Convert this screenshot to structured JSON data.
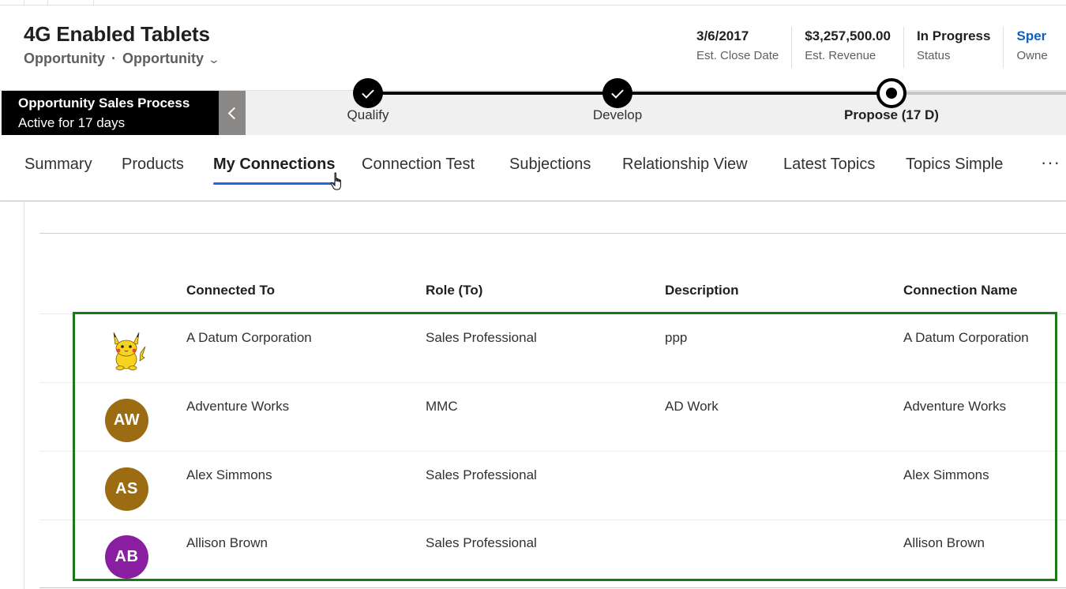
{
  "record": {
    "title": "4G Enabled Tablets",
    "entity": "Opportunity",
    "separator": "·",
    "form": "Opportunity"
  },
  "header_fields": [
    {
      "value": "3/6/2017",
      "label": "Est. Close Date"
    },
    {
      "value": "$3,257,500.00",
      "label": "Est. Revenue"
    },
    {
      "value": "In Progress",
      "label": "Status"
    },
    {
      "value": "Sper",
      "label": "Owne"
    }
  ],
  "process": {
    "name": "Opportunity Sales Process",
    "duration": "Active for 17 days",
    "stages": [
      {
        "name": "Qualify",
        "state": "completed"
      },
      {
        "name": "Develop",
        "state": "completed"
      },
      {
        "name": "Propose  (17 D)",
        "state": "active"
      }
    ]
  },
  "tabs": [
    {
      "label": "Summary",
      "active": false
    },
    {
      "label": "Products",
      "active": false
    },
    {
      "label": "My Connections",
      "active": true
    },
    {
      "label": "Connection Test",
      "active": false
    },
    {
      "label": "Subjections",
      "active": false
    },
    {
      "label": "Relationship View",
      "active": false
    },
    {
      "label": "Latest Topics",
      "active": false
    },
    {
      "label": "Topics Simple",
      "active": false
    }
  ],
  "more_label": "···",
  "grid": {
    "columns": [
      "Connected To",
      "Role (To)",
      "Description",
      "Connection Name"
    ],
    "rows": [
      {
        "avatar": "image",
        "initials": "",
        "avatar_color": "",
        "connected_to": "A Datum Corporation",
        "role": "Sales Professional",
        "description": "ppp",
        "connection_name": "A Datum Corporation"
      },
      {
        "avatar": "initials",
        "initials": "AW",
        "avatar_color": "#9b6c12",
        "connected_to": "Adventure Works",
        "role": "MMC",
        "description": "AD Work",
        "connection_name": "Adventure Works"
      },
      {
        "avatar": "initials",
        "initials": "AS",
        "avatar_color": "#9b6c12",
        "connected_to": "Alex Simmons",
        "role": "Sales Professional",
        "description": "",
        "connection_name": "Alex Simmons"
      },
      {
        "avatar": "initials",
        "initials": "AB",
        "avatar_color": "#8a1ea0",
        "connected_to": "Allison Brown",
        "role": "Sales Professional",
        "description": "",
        "connection_name": "Allison Brown"
      }
    ]
  },
  "colors": {
    "accent": "#2266e3",
    "highlight_border": "#1a7a1a",
    "link": "#1160b7"
  },
  "icons": {
    "form_selector": "chevron-down-icon",
    "process_collapse": "chevron-left-icon",
    "stage_completed": "checkmark-icon",
    "stage_active": "active-stage-icon",
    "cursor": "hand-pointer-icon"
  }
}
